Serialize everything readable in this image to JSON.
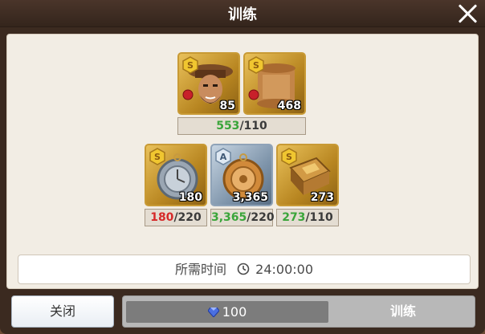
{
  "dialog": {
    "title": "训练"
  },
  "materials_top": [
    {
      "name": "captain-portrait",
      "count": "85",
      "grade": "S"
    },
    {
      "name": "captain-scroll",
      "count": "468",
      "grade": "S"
    }
  ],
  "progress_top": {
    "have": "553",
    "need": "/110"
  },
  "materials_bottom": [
    {
      "name": "pocket-compass",
      "count": "180",
      "grade": "S",
      "have": "180",
      "need": "/220",
      "sufficient": false
    },
    {
      "name": "astrolabe",
      "count": "3,365",
      "grade": "A",
      "have": "3,365",
      "need": "/220",
      "sufficient": true
    },
    {
      "name": "tome",
      "count": "273",
      "grade": "S",
      "have": "273",
      "need": "/110",
      "sufficient": true
    }
  ],
  "time": {
    "label": "所需时间",
    "value": "24:00:00"
  },
  "buttons": {
    "close": "关闭",
    "cost": "100",
    "train": "训练"
  },
  "colors": {
    "sufficient": "#3aa53a",
    "insufficient": "#d62a2a",
    "gold_card": "#c89a35",
    "blue_card": "#8fa3b8"
  }
}
